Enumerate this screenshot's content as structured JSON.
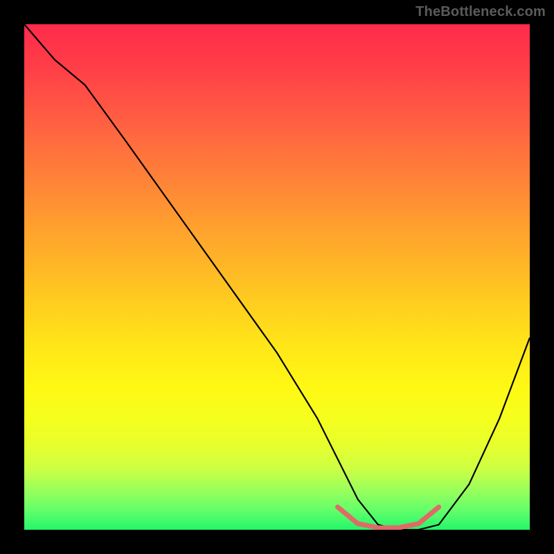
{
  "watermark": "TheBottleneck.com",
  "chart_data": {
    "type": "line",
    "title": "",
    "xlabel": "",
    "ylabel": "",
    "x_range": [
      0,
      100
    ],
    "y_range": [
      0,
      100
    ],
    "grid": false,
    "series": [
      {
        "name": "main-curve",
        "color": "#000000",
        "stroke_width": 2.2,
        "x": [
          0,
          6,
          12,
          20,
          30,
          40,
          50,
          58,
          62,
          66,
          70,
          74,
          78,
          82,
          88,
          94,
          100
        ],
        "y": [
          100,
          93,
          88,
          77,
          63,
          49,
          35,
          22,
          14,
          6,
          1,
          0,
          0,
          1,
          9,
          22,
          38
        ]
      },
      {
        "name": "bottom-marker",
        "color": "#e06a68",
        "stroke_width": 7,
        "linecap": "round",
        "x": [
          62,
          66,
          70,
          74,
          78,
          82
        ],
        "y": [
          4.5,
          1.2,
          0.4,
          0.4,
          1.2,
          4.5
        ]
      }
    ],
    "background_gradient": {
      "stops": [
        {
          "pos": 0,
          "color": "#ff2b4a"
        },
        {
          "pos": 50,
          "color": "#ffd01e"
        },
        {
          "pos": 80,
          "color": "#f5ff1e"
        },
        {
          "pos": 100,
          "color": "#25f56a"
        }
      ]
    }
  }
}
